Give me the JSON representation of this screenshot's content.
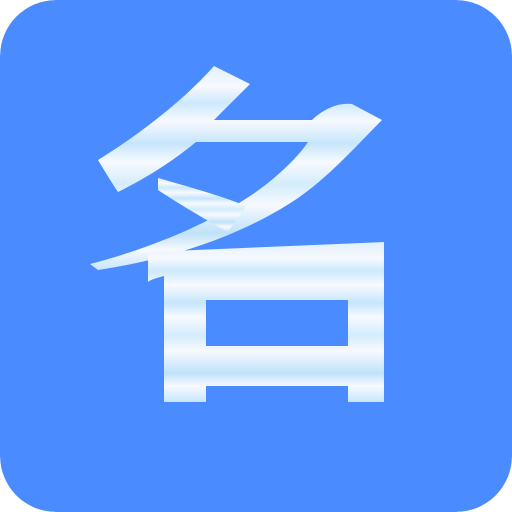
{
  "app_icon": {
    "glyph": "名",
    "colors": {
      "background": "#4a8cff",
      "glyph_light": "#f7f9ff",
      "glyph_blue": "#c6e6fb",
      "glyph_shadow": "#9fd1f3"
    }
  }
}
